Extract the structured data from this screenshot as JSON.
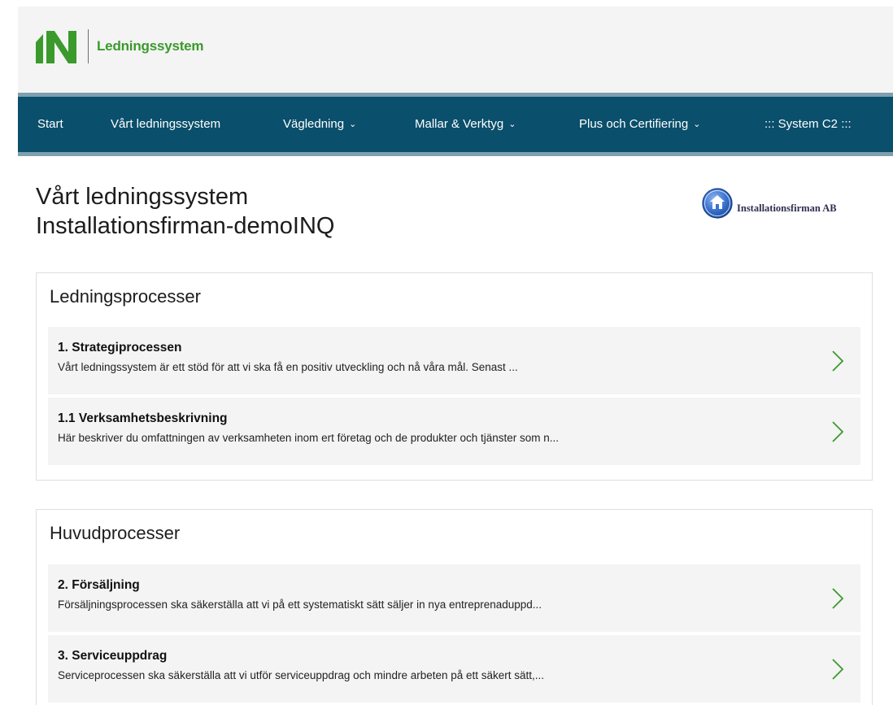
{
  "brand": {
    "name": "Ledningssystem",
    "logo_text": "IN",
    "logo_color": "#3a9a2c"
  },
  "nav": [
    {
      "label": "Start",
      "dropdown": false
    },
    {
      "label": "Vårt ledningssystem",
      "dropdown": false
    },
    {
      "label": "Vägledning",
      "dropdown": true
    },
    {
      "label": "Mallar & Verktyg",
      "dropdown": true
    },
    {
      "label": "Plus och Certifiering",
      "dropdown": true
    },
    {
      "label": "::: System C2 :::",
      "dropdown": false
    }
  ],
  "page": {
    "title_line1": "Vårt ledningssystem",
    "title_line2": "Installationsfirman-demoINQ",
    "company": "Installationsfirman AB"
  },
  "sections": [
    {
      "title": "Ledningsprocesser",
      "items": [
        {
          "title": "1. Strategiprocessen",
          "desc": "Vårt ledningssystem är ett stöd för att vi ska få en positiv utveckling och nå våra mål. Senast ..."
        },
        {
          "title": "1.1 Verksamhetsbeskrivning",
          "desc": "Här beskriver du omfattningen av verksamheten inom ert företag och de produkter och tjänster som n..."
        }
      ]
    },
    {
      "title": "Huvudprocesser",
      "items": [
        {
          "title": "2. Försäljning",
          "desc": "Försäljningsprocessen ska säkerställa att vi på ett systematiskt sätt säljer in nya entreprenaduppd..."
        },
        {
          "title": "3. Serviceuppdrag",
          "desc": "Serviceprocessen ska säkerställa att vi utför serviceuppdrag och mindre arbeten på ett säkert sätt,..."
        }
      ]
    }
  ],
  "colors": {
    "nav_bg": "#0a4f6b",
    "nav_border": "#7e9fae",
    "card_item_bg": "#f4f4f4",
    "arrow": "#3a9a2c"
  },
  "icons": {
    "item_arrow": "chevron-right-icon",
    "nav_dropdown": "chevron-down-icon",
    "company": "home-icon"
  }
}
